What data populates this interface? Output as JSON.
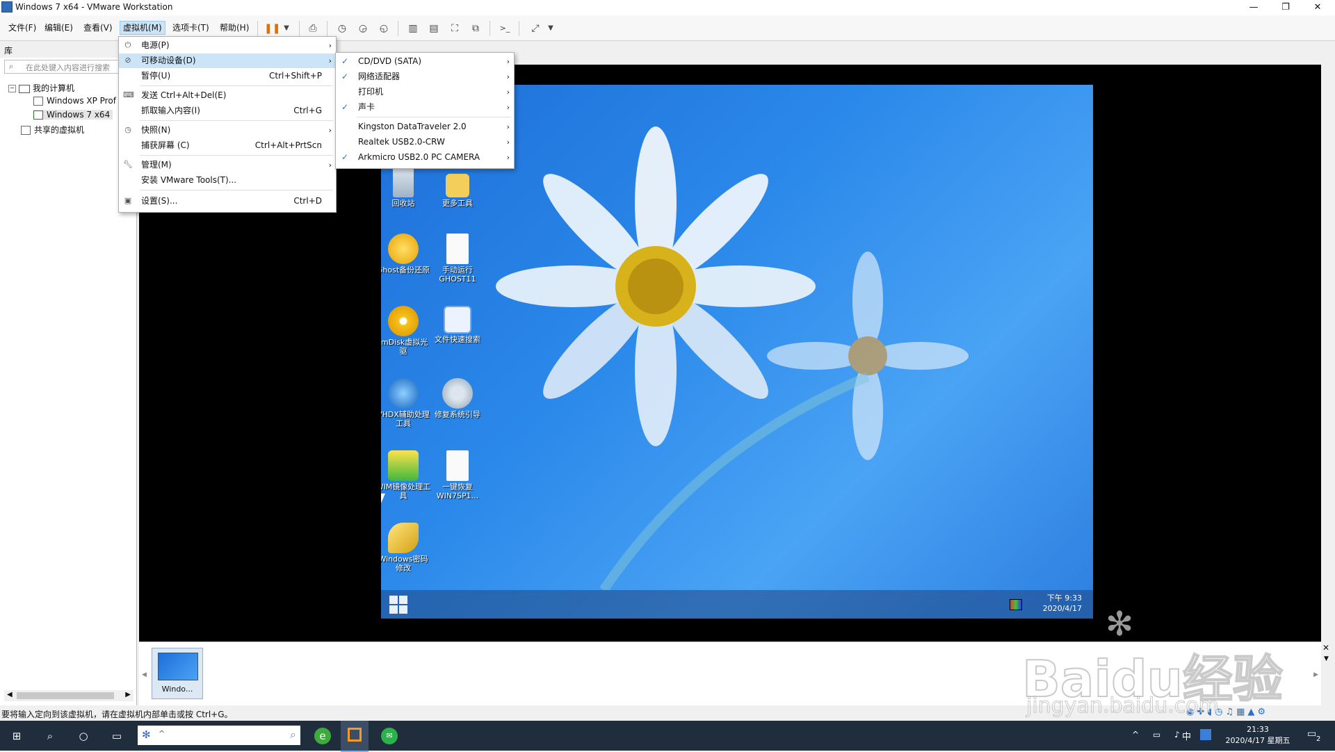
{
  "window": {
    "title": "Windows 7 x64 - VMware Workstation"
  },
  "menubar": {
    "items": [
      "文件(F)",
      "编辑(E)",
      "查看(V)",
      "虚拟机(M)",
      "选项卡(T)",
      "帮助(H)"
    ]
  },
  "library": {
    "header": "库",
    "search_placeholder": "在此处键入内容进行搜索",
    "tree": [
      "我的计算机",
      "Windows XP Prof",
      "Windows 7 x64",
      "共享的虚拟机"
    ]
  },
  "vm_menu": {
    "items": [
      {
        "label": "电源(P)",
        "shortcut": "",
        "submenu": true,
        "icon": "power-icon"
      },
      {
        "label": "可移动设备(D)",
        "shortcut": "",
        "submenu": true,
        "icon": "removable-icon",
        "highlighted": true
      },
      {
        "label": "暂停(U)",
        "shortcut": "Ctrl+Shift+P",
        "submenu": false,
        "icon": ""
      },
      {
        "label": "发送 Ctrl+Alt+Del(E)",
        "shortcut": "",
        "submenu": false,
        "icon": "keyboard-icon"
      },
      {
        "label": "抓取输入内容(I)",
        "shortcut": "Ctrl+G",
        "submenu": false,
        "icon": ""
      },
      {
        "label": "快照(N)",
        "shortcut": "",
        "submenu": true,
        "icon": "snapshot-icon"
      },
      {
        "label": "捕获屏幕 (C)",
        "shortcut": "Ctrl+Alt+PrtScn",
        "submenu": false,
        "icon": ""
      },
      {
        "label": "管理(M)",
        "shortcut": "",
        "submenu": true,
        "icon": "wrench-icon"
      },
      {
        "label": "安装 VMware Tools(T)...",
        "shortcut": "",
        "submenu": false,
        "icon": ""
      },
      {
        "label": "设置(S)...",
        "shortcut": "Ctrl+D",
        "submenu": false,
        "icon": "settings-icon"
      }
    ]
  },
  "devices_menu": {
    "items": [
      {
        "label": "CD/DVD (SATA)",
        "checked": true
      },
      {
        "label": "网络适配器",
        "checked": true
      },
      {
        "label": "打印机",
        "checked": false
      },
      {
        "label": "声卡",
        "checked": true
      },
      {
        "label": "Kingston DataTraveler 2.0",
        "checked": false
      },
      {
        "label": "Realtek USB2.0-CRW",
        "checked": false
      },
      {
        "label": "Arkmicro USB2.0 PC CAMERA",
        "checked": true
      }
    ]
  },
  "guest": {
    "icons": [
      "回收站",
      "更多工具",
      "Ghost备份还原",
      "手动运行GHOST11",
      "ImDisk虚拟光驱",
      "文件快速搜索",
      "VHDX辅助处理工具",
      "修复系统引导",
      "WIM镜像处理工具",
      "一键恢复WIN7SP1...",
      "Windows密码修改"
    ],
    "clock_time": "下午 9:33",
    "clock_date": "2020/4/17"
  },
  "thumbnail": {
    "label": "Windo..."
  },
  "status": {
    "text": "要将输入定向到该虚拟机，请在虚拟机内部单击或按 Ctrl+G。"
  },
  "taskbar": {
    "ime": "中",
    "time": "21:33",
    "date": "2020/4/17 星期五",
    "notif_count": "2"
  },
  "watermark": {
    "brand": "Baidu经验",
    "url": "jingyan.baidu.com"
  }
}
